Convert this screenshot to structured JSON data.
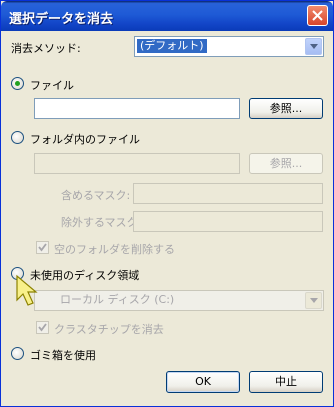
{
  "window": {
    "title": "選択データを消去"
  },
  "erase_method": {
    "label": "消去メソッド:",
    "selected": "(デフォルト)"
  },
  "file_option": {
    "label": "ファイル",
    "browse_label": "参照...",
    "path_value": ""
  },
  "folder_option": {
    "label": "フォルダ内のファイル",
    "browse_label": "参照...",
    "path_value": ""
  },
  "include_mask": {
    "label": "含めるマスク:",
    "value": ""
  },
  "exclude_mask": {
    "label": "除外するマスク:",
    "value": ""
  },
  "delete_folder": {
    "label": "空のフォルダを削除する",
    "checked": true
  },
  "unused_space": {
    "label": "未使用のディスク領域",
    "drive_selected": "ローカル ディスク (C:)"
  },
  "cluster_tips": {
    "label": "クラスタチップを消去",
    "checked": true
  },
  "recycle_bin": {
    "label": "ゴミ箱を使用"
  },
  "buttons": {
    "ok": "OK",
    "cancel": "中止"
  },
  "colors": {
    "titlebar": "#1E5AD6",
    "dialog_bg": "#ECE9D8",
    "selection": "#316AC5"
  }
}
